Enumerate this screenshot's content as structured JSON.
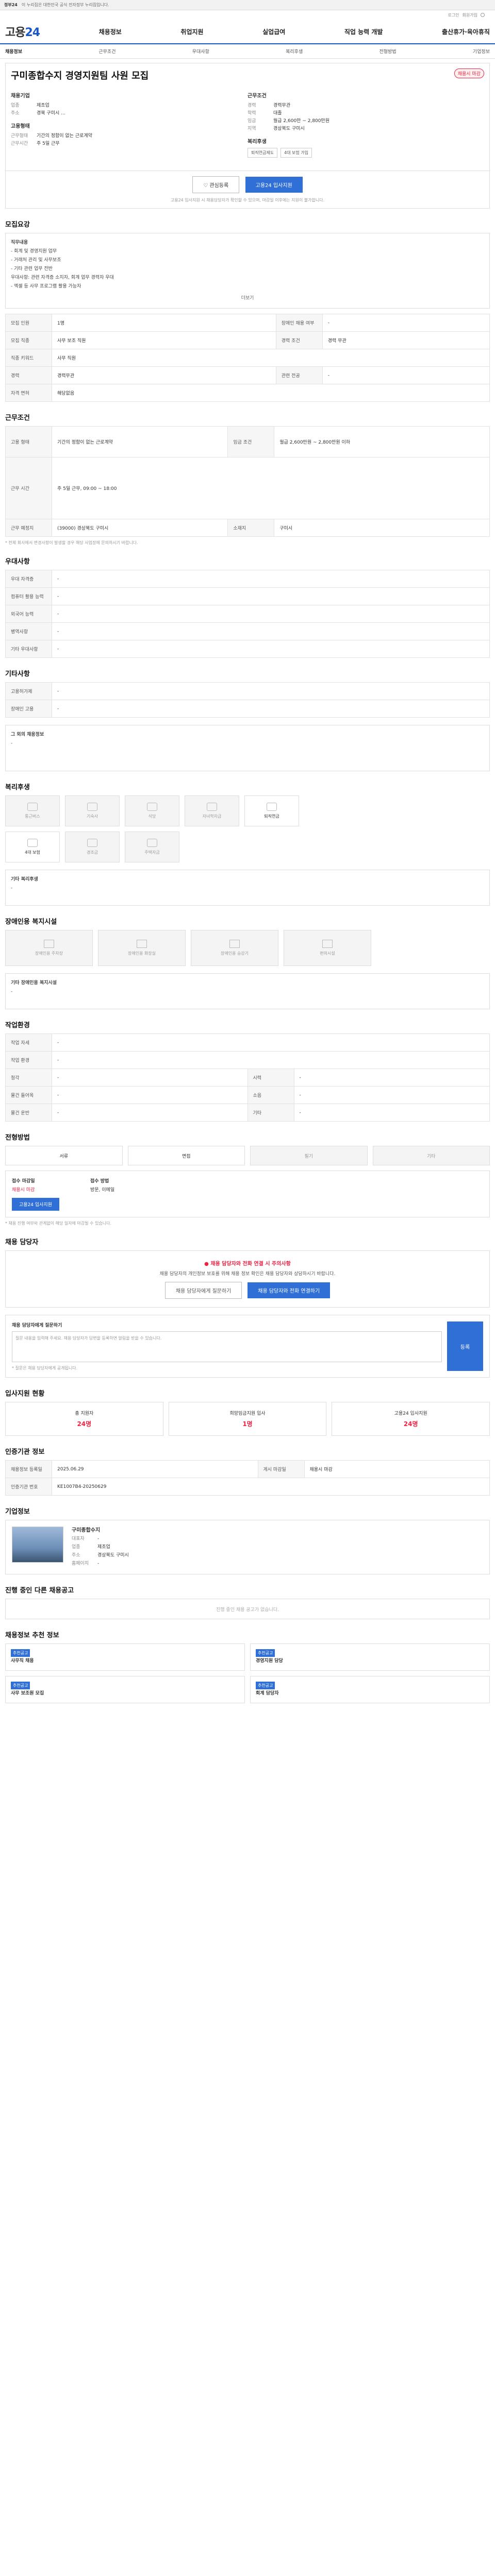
{
  "topbar": {
    "label": "정부24",
    "notice": "이 누리집은 대한민국 공식 전자정부 누리집입니다."
  },
  "util": {
    "login": "로그인",
    "join": "회원가입"
  },
  "gnb": {
    "logo_a": "고용",
    "logo_b": "24",
    "items": [
      "채용정보",
      "취업지원",
      "실업급여",
      "직업 능력 개발",
      "출산휴가·육아휴직"
    ]
  },
  "lnb": [
    "채용정보",
    "근무조건",
    "우대사항",
    "복리후생",
    "전형방법",
    "기업정보"
  ],
  "job": {
    "status": "채용시 마감",
    "title": "구미종합수지 경영지원팀 사원 모집",
    "company_label": "채용기업",
    "company_items": [
      [
        "업종",
        "제조업"
      ],
      [
        "주소",
        "경북 구미시 ..."
      ]
    ],
    "cond_label": "근무조건",
    "cond_items": [
      [
        "경력",
        "경력무관"
      ],
      [
        "학력",
        "대졸"
      ],
      [
        "임금",
        "월급 2,600만 ~ 2,800만원"
      ],
      [
        "지역",
        "경상북도 구미시"
      ]
    ],
    "grp3": "고용형태",
    "grp3_items": [
      [
        "근무형태",
        "기간의 정함이 없는 근로계약"
      ],
      [
        "근무시간",
        "주 5일 근무"
      ]
    ],
    "grp4": "복리후생",
    "chips": [
      "퇴직연금제도",
      "4대 보험 가입"
    ]
  },
  "actions": {
    "save": "관심등록",
    "apply": "고용24 입사지원",
    "note": "고용24 입사지원 시 채용담당자가 확인할 수 있으며, 마감일 이후에는 지원이 불가합니다."
  },
  "s1": {
    "h": "모집요강",
    "lines": [
      "직무내용",
      "- 회계 및 경영지원 업무",
      "- 거래처 관리 및 사무보조",
      "- 기타 관련 업무 전반",
      "우대사항: 관련 자격증 소지자, 회계 업무 경력자 우대",
      "- 엑셀 등 사무 프로그램 활용 가능자"
    ],
    "more": "더보기"
  },
  "t1": [
    [
      "모집 인원",
      "1명",
      "장애인 채용 여부",
      "-"
    ],
    [
      "모집 직종",
      "사무 보조 직원",
      "경력 조건",
      "경력 무관"
    ],
    [
      "직종 키워드",
      "사무 직원",
      "",
      ""
    ],
    [
      "경력",
      "경력무관",
      "관련 전공",
      "-"
    ],
    [
      "자격 면허",
      "해당없음",
      "",
      ""
    ]
  ],
  "s2": {
    "h": "근무조건"
  },
  "t2": [
    [
      "고용 형태",
      "기간의 정함이 없는 근로계약",
      "임금 조건",
      "월급 2,600만원 ~ 2,800만원 이하"
    ],
    [
      "근무 시간",
      "주 5일 근무, 09:00 ~ 18:00",
      "",
      ""
    ],
    [
      "근무 예정지",
      "(39000) 경상북도 구미시",
      "소재지",
      "구미시"
    ]
  ],
  "t2note": "* 전체 회사에서 변경사항이 발생할 경우 해당 사업장에 문의하시기 바랍니다.",
  "s3": {
    "h": "우대사항"
  },
  "t3": [
    [
      "우대 자격증",
      "-"
    ],
    [
      "컴퓨터 활용 능력",
      "-"
    ],
    [
      "외국어 능력",
      "-"
    ],
    [
      "병역사항",
      "-"
    ],
    [
      "기타 우대사항",
      "-"
    ]
  ],
  "s4": {
    "h": "기타사항"
  },
  "t4": [
    [
      "고용허가제",
      "-"
    ],
    [
      "장애인 고용",
      "-"
    ]
  ],
  "s4b": {
    "h": "그 외의 채용정보",
    "v": "-"
  },
  "s5": {
    "h": "복리후생",
    "items": [
      "통근버스",
      "기숙사",
      "식당",
      "자녀학자금",
      "퇴직연금",
      "4대 보험",
      "경조금",
      "주택자금"
    ],
    "note_h": "기타 복리후생",
    "note_v": "-"
  },
  "s6": {
    "h": "장애인용 복지시설",
    "items": [
      "장애인용 주차장",
      "장애인용 화장실",
      "장애인용 승강기",
      "편의시설"
    ],
    "note_h": "기타 장애인용 복지시설",
    "note_v": "-"
  },
  "s7": {
    "h": "작업환경"
  },
  "t7": [
    [
      "작업 자세",
      "-",
      "",
      ""
    ],
    [
      "작업 환경",
      "-",
      "",
      ""
    ],
    [
      "청각",
      "-",
      "시력",
      "-"
    ],
    [
      "물건 들어옥",
      "-",
      "소음",
      "-"
    ],
    [
      "물건 운반",
      "-",
      "기타",
      "-"
    ]
  ],
  "s8": {
    "h": "전형방법",
    "items": [
      "서류",
      "면접",
      "필기",
      "기타"
    ],
    "a_k": "접수 마감일",
    "a_v": "채용시 마감",
    "b_k": "접수 방법",
    "b_v": "방문, 이메일",
    "apply": "고용24 입사지원"
  },
  "s8note": "* 채용 진행 여부와 관계없이 해당 일자에 마감될 수 있습니다.",
  "s9": {
    "h": "채용 담당자",
    "alert": "채용 담당자와 전화 연결 시 주의사항",
    "alert_t": "채용 담당자의 개인정보 보호를 위해 채용 정보 확인은 채용 담당자와 상담하시기 바랍니다.",
    "b1": "채용 담당자에게 질문하기",
    "b2": "채용 담당자와 전화 연결하기"
  },
  "inq": {
    "h": "채용 담당자에게 질문하기",
    "ph": "질문 내용을 입력해 주세요. 채용 담당자가 답변을 등록하면 알림을 받을 수 있습니다.",
    "send": "등록",
    "note": "* 질문은 채용 담당자에게 공개됩니다."
  },
  "s10": {
    "h": "입사지원 현황",
    "items": [
      [
        "총 지원자",
        "24명"
      ],
      [
        "희망임금지원 입사",
        "1명"
      ],
      [
        "고용24 입사지원",
        "24명"
      ]
    ]
  },
  "s11": {
    "h": "인증기관 정보"
  },
  "t11": [
    [
      "채용정보 등록일",
      "2025.06.29",
      "게시 마감일",
      "채용시 마감"
    ],
    [
      "인증기관 번호",
      "KE1007B4-20250629"
    ]
  ],
  "s12": {
    "h": "기업정보",
    "company": "구미종합수지",
    "rows": [
      [
        "대표자",
        "-"
      ],
      [
        "업종",
        "제조업"
      ],
      [
        "주소",
        "경상북도 구미시"
      ],
      [
        "홈페이지",
        "-"
      ]
    ]
  },
  "s13": {
    "h": "진행 중인 다른 채용공고",
    "empty": "진행 중인 채용 공고가 없습니다."
  },
  "s14": {
    "h": "채용정보 추천 정보",
    "cards": [
      [
        "추천공고",
        "사무직 채용"
      ],
      [
        "추천공고",
        "경영지원 담당"
      ],
      [
        "추천공고",
        "사무 보조원 모집"
      ],
      [
        "추천공고",
        "회계 담당자"
      ]
    ]
  }
}
